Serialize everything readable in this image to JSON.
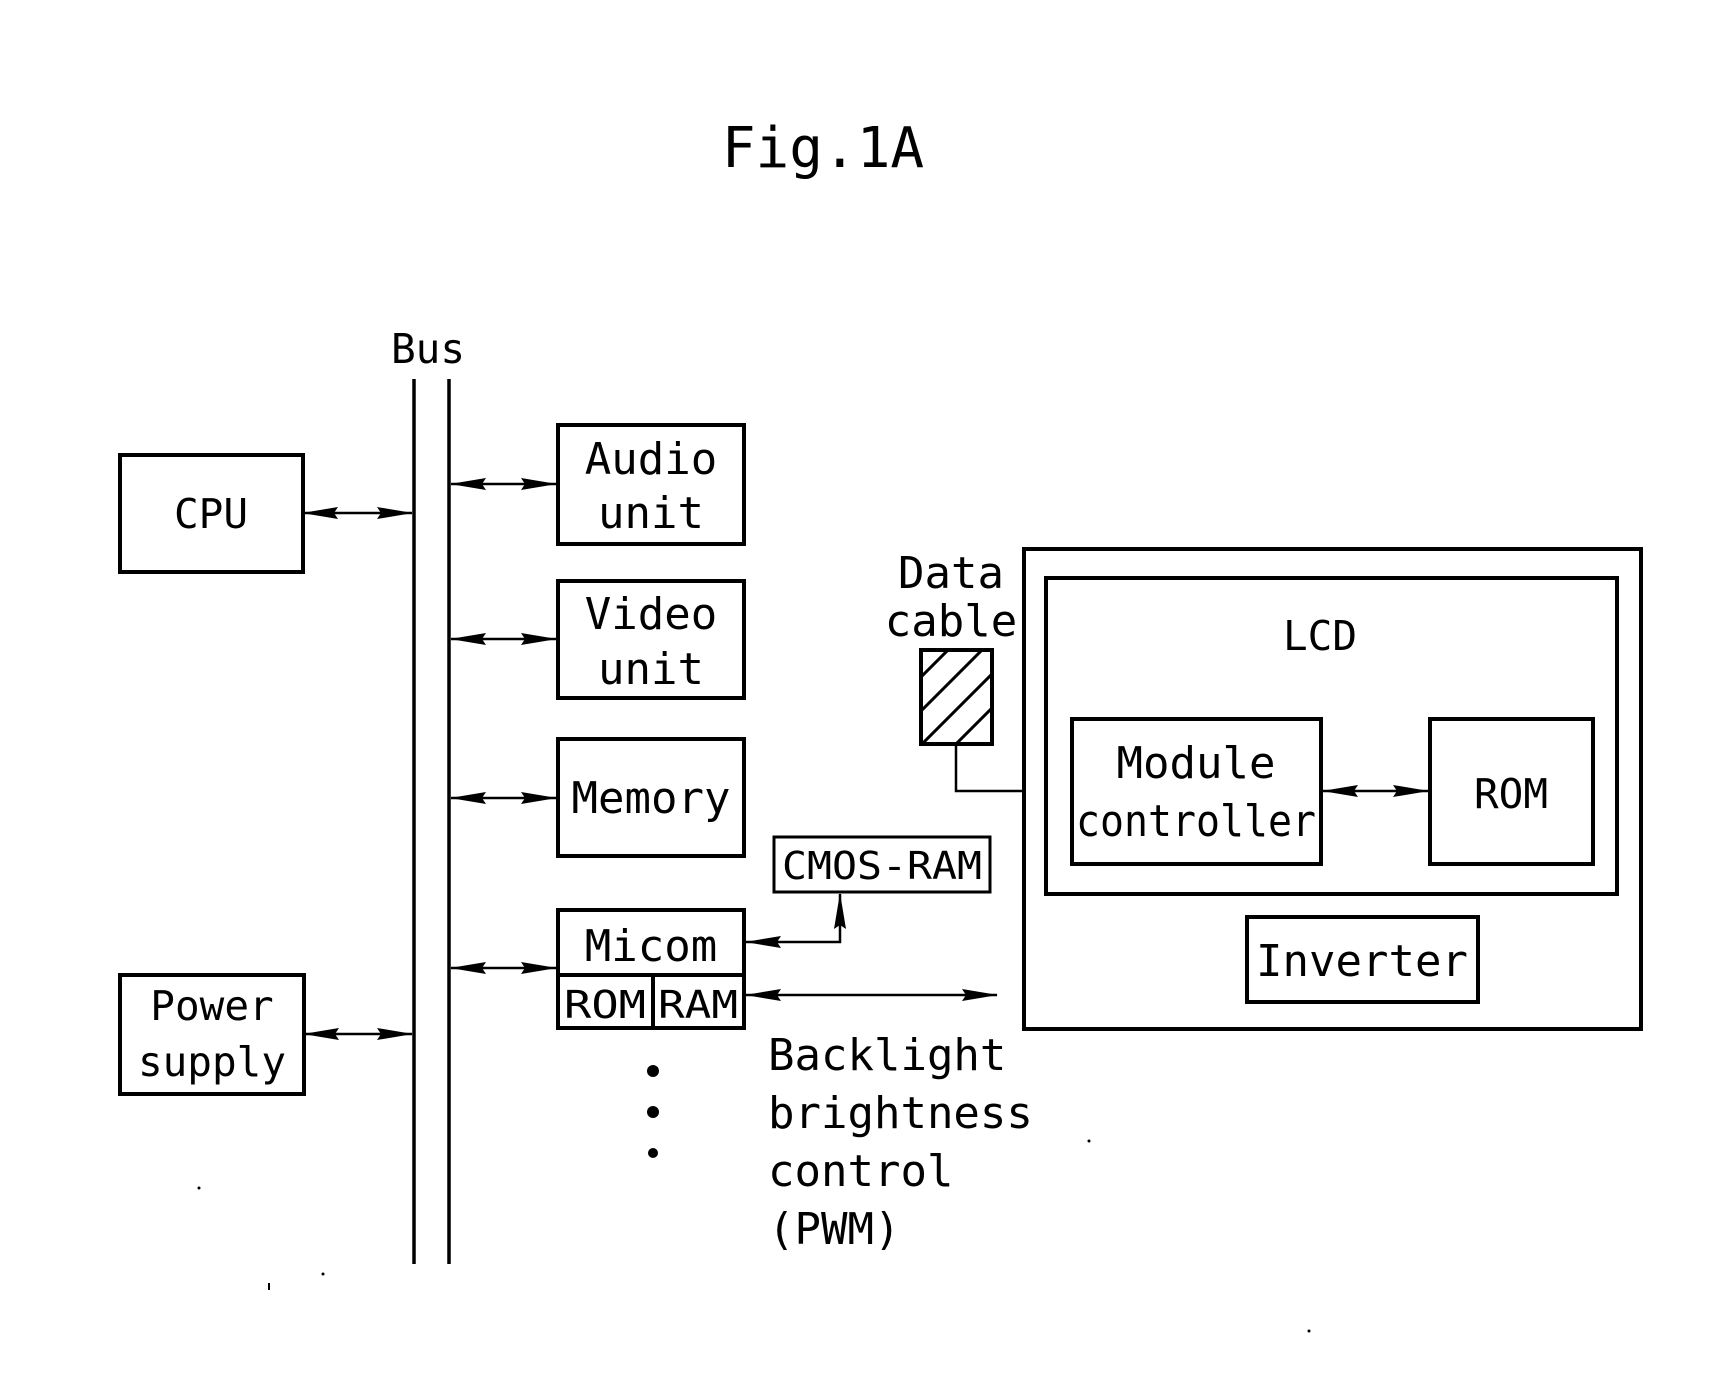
{
  "figure": {
    "title": "Fig.1A",
    "bus_label": "Bus"
  },
  "blocks": {
    "cpu": [
      "CPU"
    ],
    "power_supply": [
      "Power",
      "supply"
    ],
    "audio_unit": [
      "Audio",
      "unit"
    ],
    "video_unit": [
      "Video",
      "unit"
    ],
    "memory": [
      "Memory"
    ],
    "micom": [
      "Micom"
    ],
    "micom_rom": [
      "ROM"
    ],
    "micom_ram": [
      "RAM"
    ],
    "cmos_ram": [
      "CMOS-RAM"
    ],
    "data_cable": [
      "Data",
      "cable"
    ],
    "lcd": [
      "LCD"
    ],
    "module_controller": [
      "Module",
      "controller"
    ],
    "lcd_rom": [
      "ROM"
    ],
    "inverter": [
      "Inverter"
    ]
  },
  "annotations": {
    "backlight": [
      "Backlight",
      "brightness",
      "control",
      "(PWM)"
    ],
    "continuation": "more bus devices (vertical ellipsis)"
  },
  "connections": [
    {
      "from": "CPU",
      "to": "Bus",
      "type": "bidirectional"
    },
    {
      "from": "Power supply",
      "to": "Bus",
      "type": "bidirectional"
    },
    {
      "from": "Bus",
      "to": "Audio unit",
      "type": "bidirectional"
    },
    {
      "from": "Bus",
      "to": "Video unit",
      "type": "bidirectional"
    },
    {
      "from": "Bus",
      "to": "Memory",
      "type": "bidirectional"
    },
    {
      "from": "Bus",
      "to": "Micom",
      "type": "bidirectional"
    },
    {
      "from": "Micom",
      "to": "CMOS-RAM",
      "type": "bidirectional"
    },
    {
      "from": "Micom",
      "to": "Inverter",
      "type": "bidirectional",
      "label": "Backlight brightness control (PWM)"
    },
    {
      "from": "Data cable",
      "to": "Module controller",
      "type": "directed"
    },
    {
      "from": "Module controller",
      "to": "ROM",
      "type": "bidirectional"
    }
  ]
}
